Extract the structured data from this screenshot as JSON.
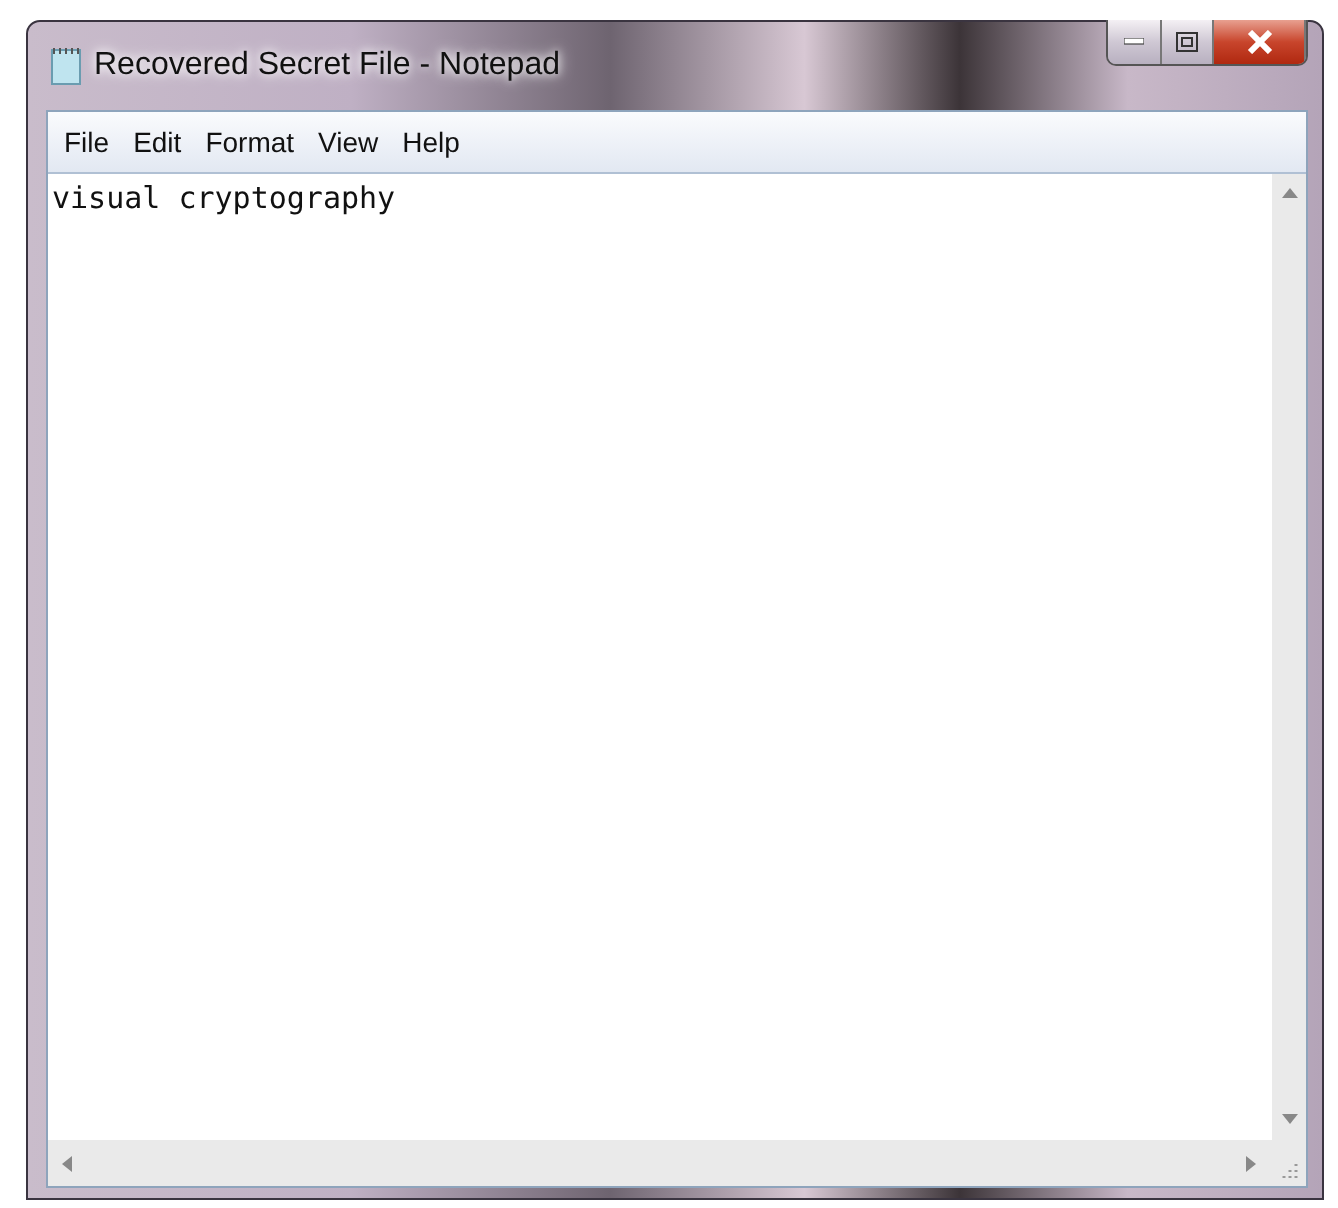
{
  "window": {
    "title": "Recovered Secret File - Notepad"
  },
  "menu": [
    "File",
    "Edit",
    "Format",
    "View",
    "Help"
  ],
  "document": {
    "text": "visual cryptography"
  }
}
